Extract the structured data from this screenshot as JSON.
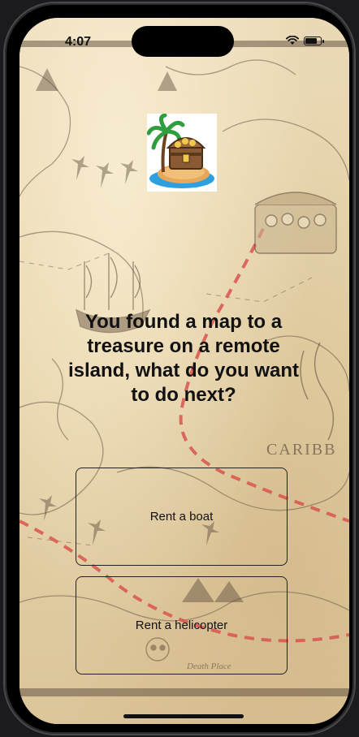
{
  "status_bar": {
    "time": "4:07",
    "battery_level": 0.85
  },
  "logo": {
    "icon": "treasure-island-icon"
  },
  "story": {
    "text": "You found a map to a treasure on a remote island, what do you want to do next?"
  },
  "choices": [
    {
      "label": "Rent a boat"
    },
    {
      "label": "Rent a helicopter"
    }
  ],
  "map": {
    "label_caribbean": "CARIBB",
    "label_death_place": "Death Place"
  },
  "colors": {
    "parchment": "#e8d7b3",
    "ink": "#5b4a3a",
    "route": "#d9544f",
    "text": "#111111"
  }
}
